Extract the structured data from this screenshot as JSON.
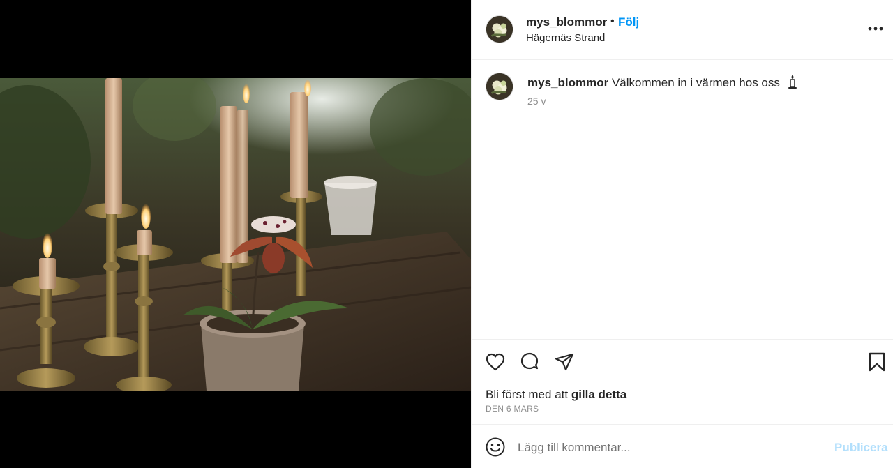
{
  "post": {
    "username": "mys_blommor",
    "dot": "•",
    "follow_label": "Följ",
    "location": "Hägernäs Strand",
    "more_icon": "more-horizontal-icon"
  },
  "caption": {
    "username": "mys_blommor",
    "text": "Välkommen in i värmen hos oss",
    "emoji": "candle-emoji",
    "time_ago": "25 v"
  },
  "actions": {
    "like_icon": "heart-icon",
    "comment_icon": "comment-bubble-icon",
    "share_icon": "paper-plane-icon",
    "save_icon": "bookmark-icon"
  },
  "likes": {
    "prefix": "Bli först med att ",
    "bold": "gilla detta"
  },
  "date": "DEN 6 MARS",
  "comment_box": {
    "emoji_icon": "smiley-icon",
    "placeholder": "Lägg till kommentar...",
    "publish_label": "Publicera"
  },
  "colors": {
    "accent": "#0095f6",
    "publish_disabled": "#b2dffc",
    "secondary_text": "#8e8e8e",
    "divider": "#efefef"
  }
}
